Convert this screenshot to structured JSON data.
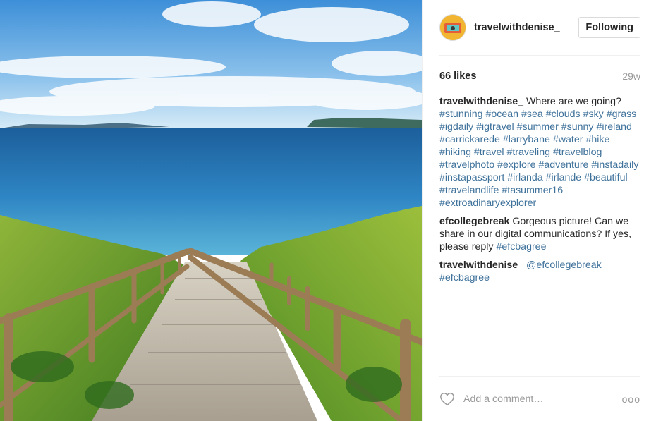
{
  "post": {
    "username": "travelwithdenise_",
    "follow_label": "Following",
    "likes": "66 likes",
    "age": "29w",
    "comments": [
      {
        "author": "travelwithdenise_",
        "text": "Where are we going?",
        "hashtags": [
          "#stunning",
          "#ocean",
          "#sea",
          "#clouds",
          "#sky",
          "#grass",
          "#igdaily",
          "#igtravel",
          "#summer",
          "#sunny",
          "#ireland",
          "#carrickarede",
          "#larrybane",
          "#water",
          "#hike",
          "#hiking",
          "#travel",
          "#traveling",
          "#travelblog",
          "#travelphoto",
          "#explore",
          "#adventure",
          "#instadaily",
          "#instapassport",
          "#irlanda",
          "#irlande",
          "#beautiful",
          "#travelandlife",
          "#tasummer16",
          "#extroadinaryexplorer"
        ]
      },
      {
        "author": "efcollegebreak",
        "text": "Gorgeous picture! Can we share in our digital communications? If yes, please reply",
        "hashtags": [
          "#efcbagree"
        ]
      },
      {
        "author": "travelwithdenise_",
        "text": "",
        "mention": "@efcollegebreak",
        "hashtags": [
          "#efcbagree"
        ]
      }
    ],
    "comment_placeholder": "Add a comment…",
    "more_label": "ooo"
  },
  "icons": {
    "heart": "heart-outline-icon",
    "more": "more-options-icon"
  },
  "colors": {
    "hashtag": "#3f729b",
    "text": "#262626",
    "muted": "#999999",
    "border": "#efefef"
  }
}
